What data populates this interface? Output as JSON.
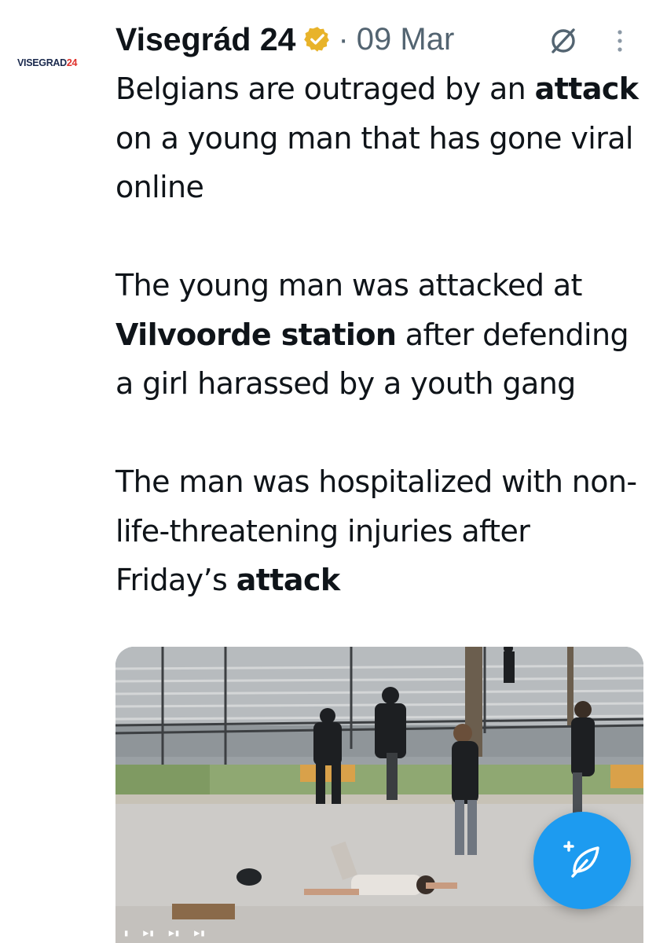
{
  "author": {
    "avatar_text_main": "VISEGRAD",
    "avatar_text_num": "24",
    "display_name": "Visegrád 24",
    "verified_badge_icon": "verified-gold-badge-icon",
    "separator": "·",
    "date": "09 Mar"
  },
  "header_icons": {
    "grok": "grok-icon",
    "more": "more-vertical-icon"
  },
  "tweet": {
    "p1_a": "Belgians are outraged by an ",
    "p1_bold": "attack",
    "p1_b": " on a young man that has gone viral online",
    "p2_a": "The young man was attacked at ",
    "p2_bold": "Vilvoorde station",
    "p2_b": " after defending a girl harassed by a youth gang",
    "p3_a": "The man was hospitalized with non-life-threatening injuries after Friday’s ",
    "p3_bold": "attack"
  },
  "media": {
    "kind": "video-still",
    "player_controls": [
      "▮",
      "▶▮",
      "▶▮",
      "▶▮"
    ]
  },
  "fab": {
    "icon": "compose-post-icon",
    "accent": "#1d9bf0"
  },
  "colors": {
    "text": "#0f1419",
    "muted": "#536471",
    "badge": "#e8b32a",
    "accent": "#1d9bf0"
  }
}
